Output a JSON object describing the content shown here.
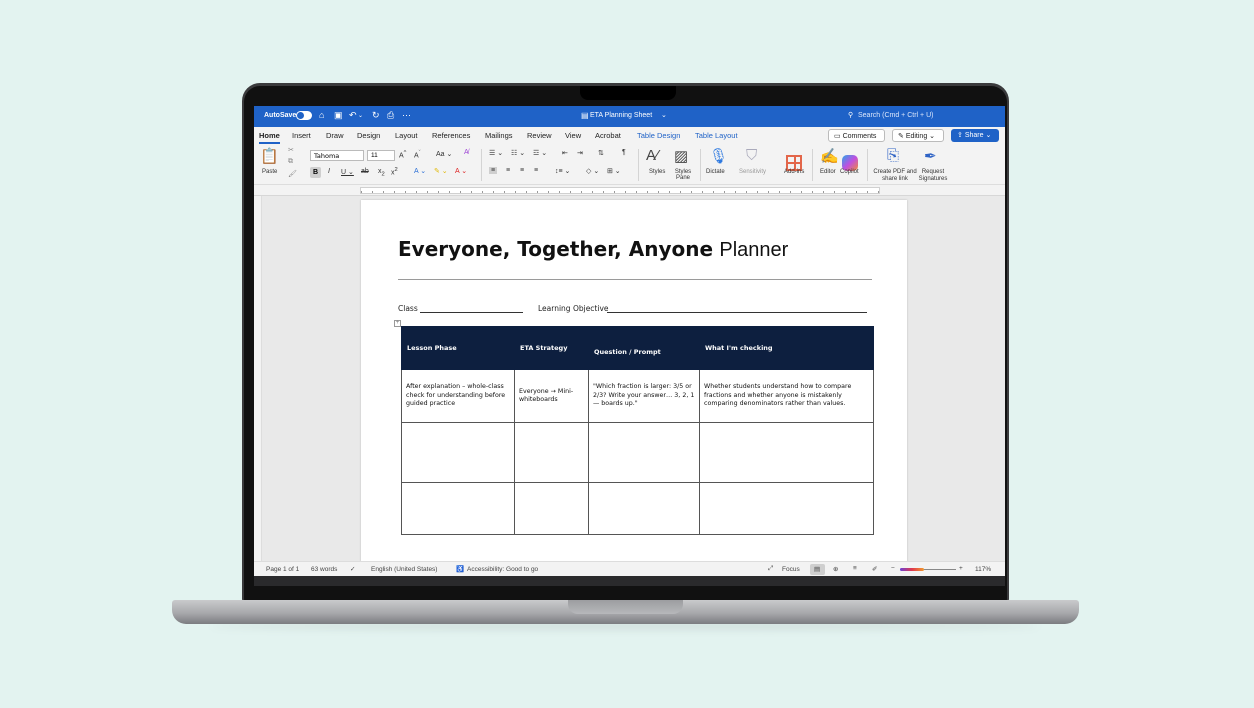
{
  "titlebar": {
    "autosave_label": "AutoSave",
    "doc_title": "ETA Planning Sheet",
    "search_placeholder": "Search (Cmd + Ctrl + U)"
  },
  "tabs": [
    "Home",
    "Insert",
    "Draw",
    "Design",
    "Layout",
    "References",
    "Mailings",
    "Review",
    "View",
    "Acrobat",
    "Table Design",
    "Table Layout"
  ],
  "header_buttons": {
    "comments": "Comments",
    "editing": "Editing",
    "share": "Share"
  },
  "ribbon": {
    "paste": "Paste",
    "font_name": "Tahoma",
    "font_size": "11",
    "styles": "Styles",
    "styles_pane": "Styles Pane",
    "dictate": "Dictate",
    "sensitivity": "Sensitivity",
    "addins": "Add-ins",
    "editor": "Editor",
    "copilot": "Copilot",
    "create_pdf": "Create PDF and share link",
    "request_signatures": "Request Signatures"
  },
  "document": {
    "title_bold": "Everyone, Together, Anyone",
    "title_light": "Planner",
    "class_label": "Class",
    "objective_label": "Learning Objective",
    "table": {
      "headers": [
        "Lesson Phase",
        "ETA Strategy",
        "Question / Prompt",
        "What I'm checking"
      ],
      "rows": [
        [
          "After explanation – whole-class check for understanding before guided practice",
          "Everyone → Mini-whiteboards",
          "\"Which fraction is larger: 3/5 or 2/3? Write your answer… 3, 2, 1 — boards up.\"",
          "Whether students understand how to compare fractions and whether anyone is mistakenly comparing denominators rather than values."
        ],
        [
          "",
          "",
          "",
          ""
        ],
        [
          "",
          "",
          "",
          ""
        ]
      ]
    }
  },
  "statusbar": {
    "page": "Page 1 of 1",
    "words": "63 words",
    "language": "English (United States)",
    "accessibility": "Accessibility: Good to go",
    "focus": "Focus",
    "zoom": "117%"
  }
}
